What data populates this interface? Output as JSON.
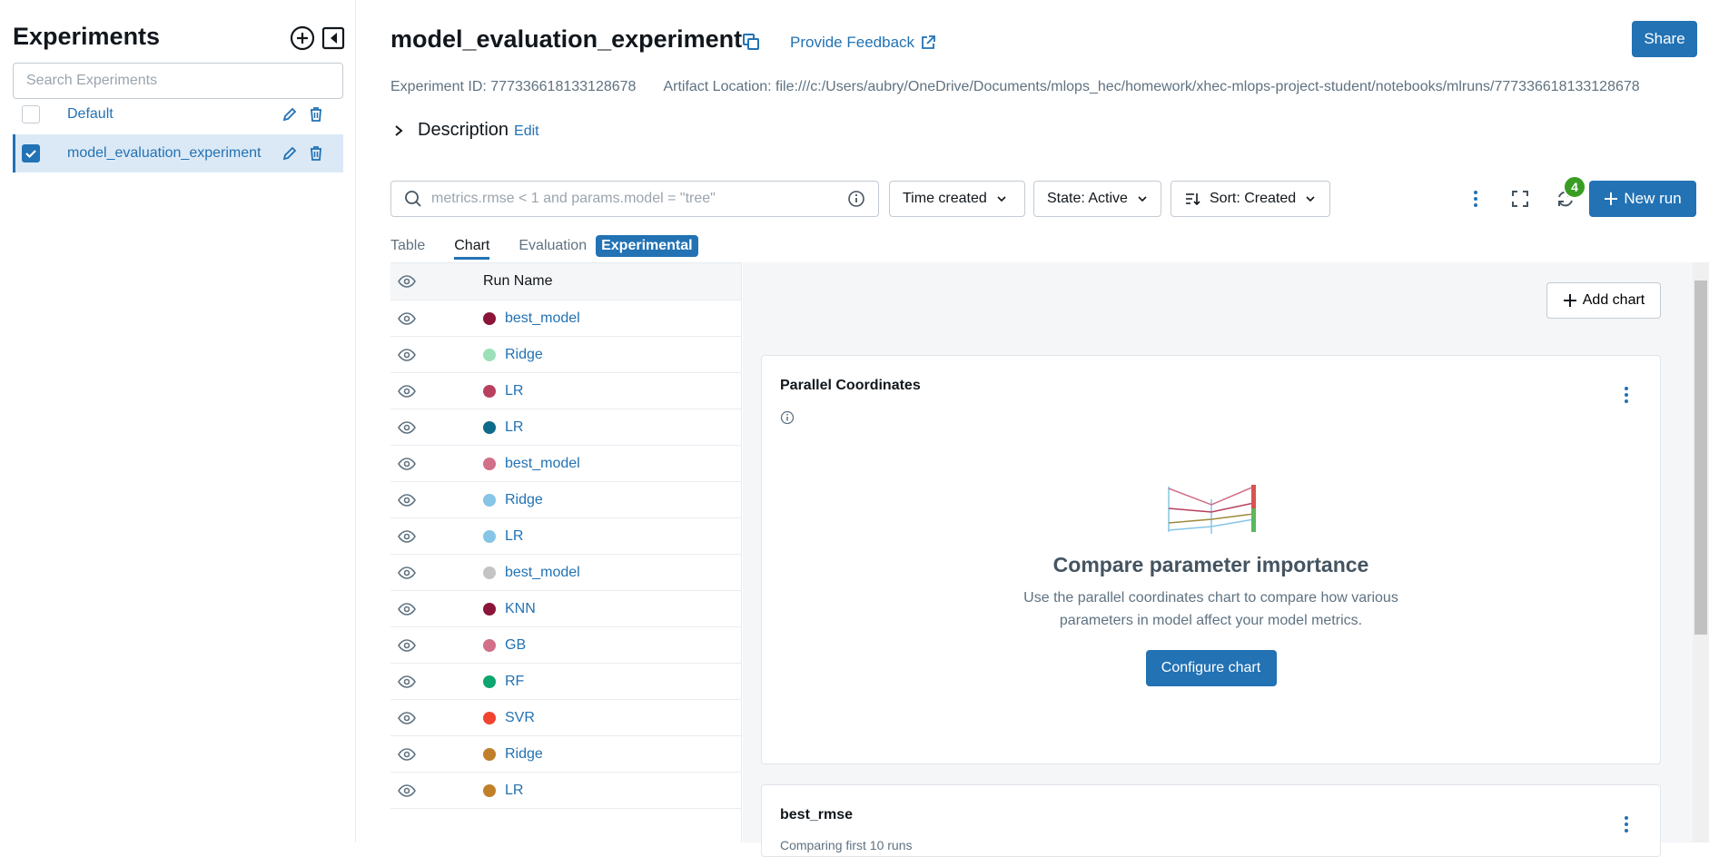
{
  "sidebar": {
    "title": "Experiments",
    "search_placeholder": "Search Experiments",
    "items": [
      {
        "label": "Default",
        "checked": false
      },
      {
        "label": "model_evaluation_experiment",
        "checked": true
      }
    ]
  },
  "header": {
    "title": "model_evaluation_experiment",
    "feedback_label": "Provide Feedback",
    "share_label": "Share",
    "experiment_id": "Experiment ID: 777336618133128678",
    "artifact_location": "Artifact Location: file:///c:/Users/aubry/OneDrive/Documents/mlops_hec/homework/xhec-mlops-project-student/notebooks/mlruns/777336618133128678",
    "description_label": "Description",
    "edit_label": "Edit"
  },
  "toolbar": {
    "filter_placeholder": "metrics.rmse < 1 and params.model = \"tree\"",
    "time_created": "Time created",
    "state": "State: Active",
    "sort": "Sort: Created",
    "badge_count": "4",
    "new_run_label": "New run"
  },
  "tabs": [
    {
      "label": "Table",
      "active": false
    },
    {
      "label": "Chart",
      "active": true
    },
    {
      "label": "Evaluation",
      "active": false
    },
    {
      "label": "Experimental",
      "active": false
    }
  ],
  "runs": {
    "header": "Run Name",
    "rows": [
      {
        "name": "best_model",
        "color": "#8b1538"
      },
      {
        "name": "Ridge",
        "color": "#9de0b8"
      },
      {
        "name": "LR",
        "color": "#b8405e"
      },
      {
        "name": "LR",
        "color": "#0f6b8a"
      },
      {
        "name": "best_model",
        "color": "#d17088"
      },
      {
        "name": "Ridge",
        "color": "#86c5e6"
      },
      {
        "name": "LR",
        "color": "#86c5e6"
      },
      {
        "name": "best_model",
        "color": "#c4c4c4"
      },
      {
        "name": "KNN",
        "color": "#8b1538"
      },
      {
        "name": "GB",
        "color": "#d17088"
      },
      {
        "name": "RF",
        "color": "#0ca66e"
      },
      {
        "name": "SVR",
        "color": "#f04430"
      },
      {
        "name": "Ridge",
        "color": "#c0802a"
      },
      {
        "name": "LR",
        "color": "#c0802a"
      }
    ]
  },
  "charts": {
    "add_chart_label": "Add chart",
    "parallel": {
      "title": "Parallel Coordinates",
      "empty_title": "Compare parameter importance",
      "empty_desc_1": "Use the parallel coordinates chart to compare how various",
      "empty_desc_2": "parameters in model affect your model metrics.",
      "configure_label": "Configure chart"
    },
    "best_rmse": {
      "title": "best_rmse",
      "subtitle": "Comparing first 10 runs"
    }
  },
  "colors": {
    "accent": "#2272b4",
    "badge": "#3a9d23"
  }
}
